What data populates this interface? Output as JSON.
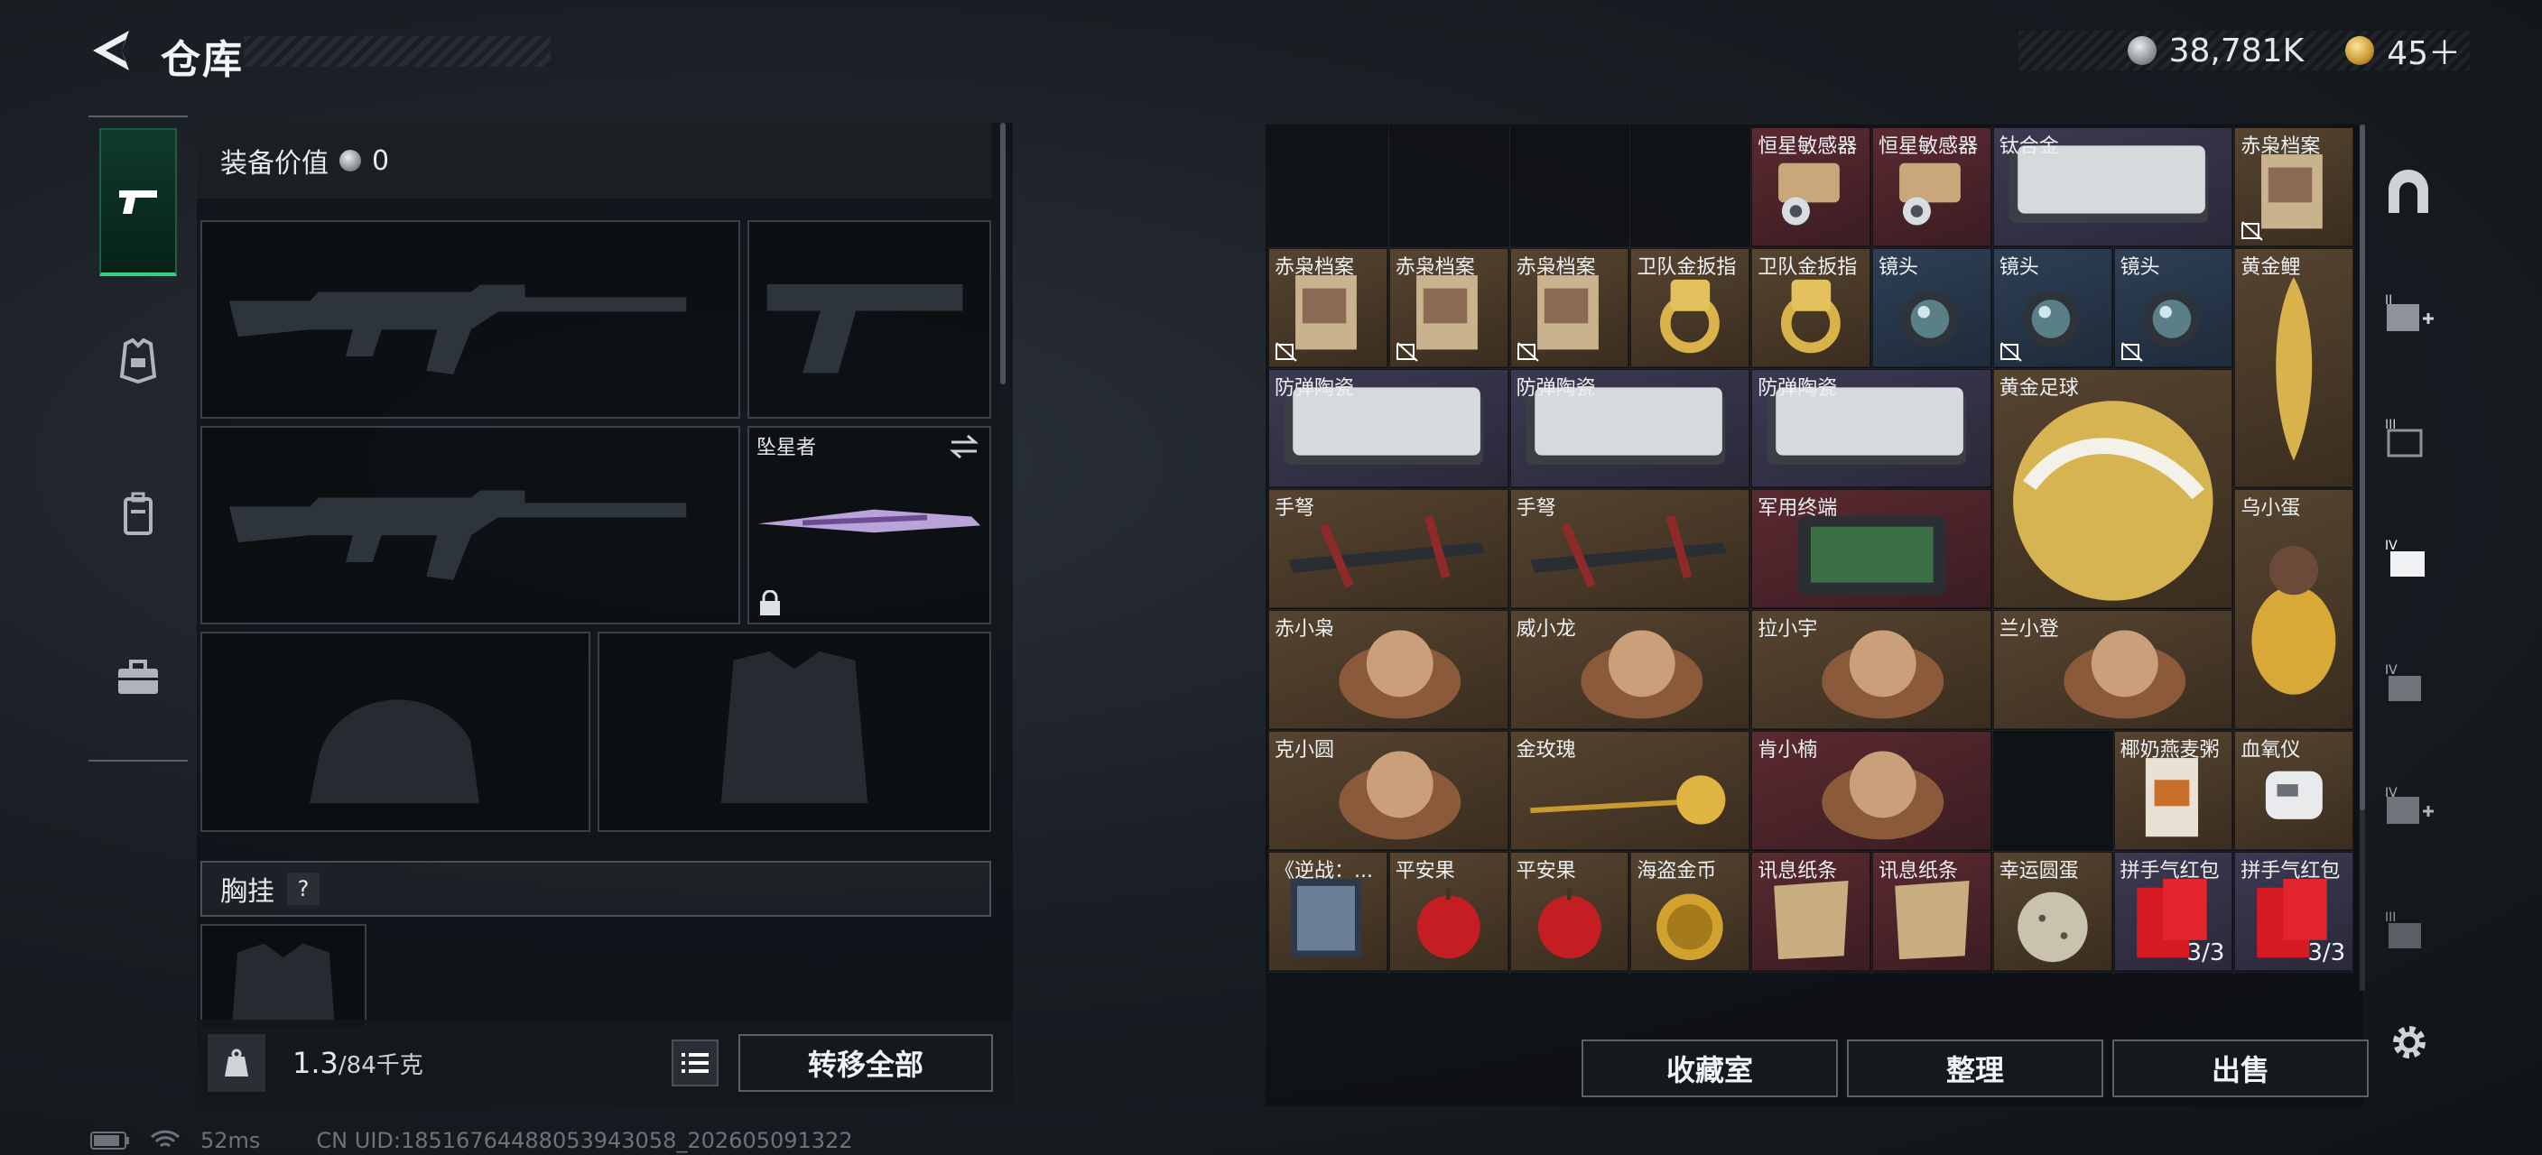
{
  "header": {
    "title": "仓库",
    "currency_silver": "38,781K",
    "currency_gold": "45＋"
  },
  "loadout": {
    "equip_value_label": "装备价值",
    "equip_value": "0",
    "melee_slot_label": "坠星者",
    "chest_label": "胸挂",
    "chest_help": "?",
    "weight_current": "1.3",
    "weight_max": "/84千克",
    "transfer_all": "转移全部"
  },
  "stash": {
    "items": [
      {
        "id": "i1",
        "name": "恒星敏感器",
        "rarity": "red"
      },
      {
        "id": "i2",
        "name": "恒星敏感器",
        "rarity": "red"
      },
      {
        "id": "i3",
        "name": "钛合金",
        "rarity": "purple"
      },
      {
        "id": "i4",
        "name": "赤枭档案",
        "rarity": "gold"
      },
      {
        "id": "i5",
        "name": "赤枭档案",
        "rarity": "gold"
      },
      {
        "id": "i6",
        "name": "赤枭档案",
        "rarity": "gold"
      },
      {
        "id": "i7",
        "name": "赤枭档案",
        "rarity": "gold"
      },
      {
        "id": "i8",
        "name": "卫队金扳指",
        "rarity": "gold"
      },
      {
        "id": "i9",
        "name": "卫队金扳指",
        "rarity": "gold"
      },
      {
        "id": "i10",
        "name": "镜头",
        "rarity": "blue"
      },
      {
        "id": "i11",
        "name": "镜头",
        "rarity": "blue"
      },
      {
        "id": "i12",
        "name": "镜头",
        "rarity": "blue"
      },
      {
        "id": "i13",
        "name": "黄金鲤",
        "rarity": "gold"
      },
      {
        "id": "i14",
        "name": "防弹陶瓷",
        "rarity": "purple"
      },
      {
        "id": "i15",
        "name": "防弹陶瓷",
        "rarity": "purple"
      },
      {
        "id": "i16",
        "name": "防弹陶瓷",
        "rarity": "purple"
      },
      {
        "id": "i17",
        "name": "黄金足球",
        "rarity": "gold"
      },
      {
        "id": "i18",
        "name": "手弩",
        "rarity": "gold"
      },
      {
        "id": "i19",
        "name": "手弩",
        "rarity": "gold"
      },
      {
        "id": "i20",
        "name": "军用终端",
        "rarity": "red"
      },
      {
        "id": "i21",
        "name": "乌小蛋",
        "rarity": "gold"
      },
      {
        "id": "i22",
        "name": "赤小枭",
        "rarity": "gold"
      },
      {
        "id": "i23",
        "name": "威小龙",
        "rarity": "gold"
      },
      {
        "id": "i24",
        "name": "拉小宇",
        "rarity": "gold"
      },
      {
        "id": "i25",
        "name": "兰小登",
        "rarity": "gold"
      },
      {
        "id": "i26",
        "name": "克小圆",
        "rarity": "gold"
      },
      {
        "id": "i27",
        "name": "金玫瑰",
        "rarity": "gold"
      },
      {
        "id": "i28",
        "name": "肯小楠",
        "rarity": "red"
      },
      {
        "id": "i29",
        "name": "椰奶燕麦粥",
        "rarity": "gold"
      },
      {
        "id": "i30",
        "name": "血氧仪",
        "rarity": "gold"
      },
      {
        "id": "i31",
        "name": "《逆战：...",
        "rarity": "gold"
      },
      {
        "id": "i32",
        "name": "平安果",
        "rarity": "gold"
      },
      {
        "id": "i33",
        "name": "平安果",
        "rarity": "gold"
      },
      {
        "id": "i34",
        "name": "海盗金币",
        "rarity": "gold"
      },
      {
        "id": "i35",
        "name": "讯息纸条",
        "rarity": "red"
      },
      {
        "id": "i36",
        "name": "讯息纸条",
        "rarity": "red"
      },
      {
        "id": "i37",
        "name": "幸运圆蛋",
        "rarity": "gold"
      },
      {
        "id": "i38",
        "name": "拼手气红包",
        "rarity": "purple",
        "count": "3/3"
      },
      {
        "id": "i39",
        "name": "拼手气红包",
        "rarity": "purple",
        "count": "3/3"
      }
    ],
    "buttons": {
      "collection": "收藏室",
      "sort": "整理",
      "sell": "出售"
    }
  },
  "status": {
    "ping": "52ms",
    "uid": "CN UID:1851676448805394305​8_202605091322"
  },
  "colors": {
    "accent_green": "#33d08a",
    "rarity_red": "#5a2a30",
    "rarity_gold": "#564430",
    "rarity_purple": "#3c3a52",
    "rarity_blue": "#2f3f55"
  }
}
